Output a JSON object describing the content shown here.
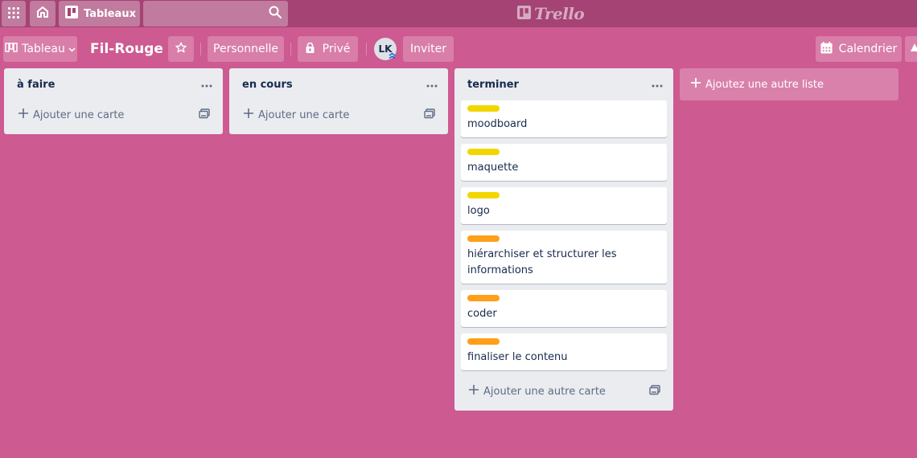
{
  "header": {
    "boards_label": "Tableaux",
    "search_value": "",
    "logo_text": "Trello"
  },
  "board": {
    "view_label": "Tableau",
    "title": "Fil-Rouge",
    "team_label": "Personnelle",
    "visibility_label": "Privé",
    "member_initials": "LK",
    "invite_label": "Inviter",
    "calendar_label": "Calendrier"
  },
  "colors": {
    "background": "#cd5a91",
    "header": "#a54374",
    "label_yellow": "#f2d600",
    "label_orange": "#ff9f1a"
  },
  "lists": [
    {
      "title": "à faire",
      "add_card_label": "Ajouter une carte",
      "cards": []
    },
    {
      "title": "en cours",
      "add_card_label": "Ajouter une carte",
      "cards": []
    },
    {
      "title": "terminer",
      "add_card_label": "Ajouter une autre carte",
      "cards": [
        {
          "title": "moodboard",
          "label_color": "yellow"
        },
        {
          "title": "maquette",
          "label_color": "yellow"
        },
        {
          "title": "logo",
          "label_color": "yellow"
        },
        {
          "title": "hiérarchiser et structurer les informations",
          "label_color": "orange"
        },
        {
          "title": "coder",
          "label_color": "orange"
        },
        {
          "title": "finaliser le contenu",
          "label_color": "orange"
        }
      ]
    }
  ],
  "add_list_label": "Ajoutez une autre liste",
  "icons": {
    "apps": "grid-icon",
    "home": "home-icon",
    "boards": "board-icon",
    "search": "search-icon",
    "star": "star-icon",
    "lock": "lock-icon",
    "calendar": "calendar-icon",
    "menu": "ellipsis-icon",
    "add": "plus-icon",
    "template": "card-template-icon"
  }
}
